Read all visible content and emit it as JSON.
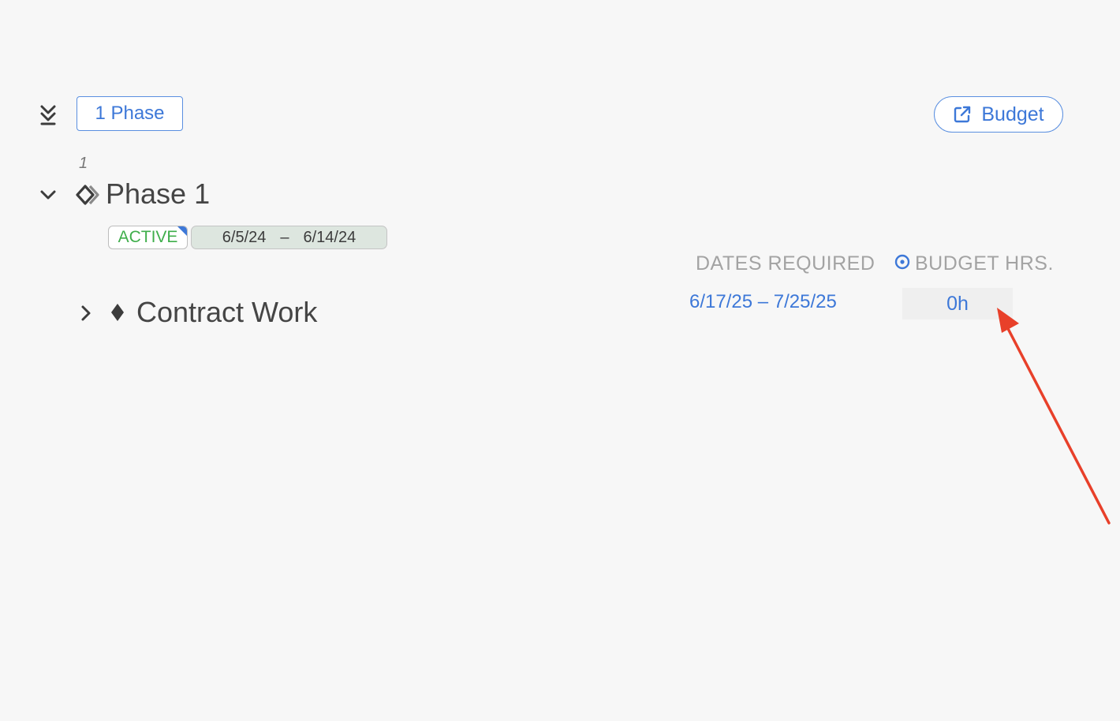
{
  "toolbar": {
    "phase_count_label": "1 Phase",
    "budget_label": "Budget"
  },
  "phase": {
    "number": "1",
    "title": "Phase 1",
    "status": "ACTIVE",
    "start_date": "6/5/24",
    "date_separator": "–",
    "end_date": "6/14/24"
  },
  "columns": {
    "dates_header": "DATES REQUIRED",
    "budget_header": "BUDGET HRS."
  },
  "rows": [
    {
      "title": "Contract Work",
      "dates": "6/17/25 – 7/25/25",
      "budget_hours": "0h"
    }
  ],
  "colors": {
    "accent": "#3d78d8",
    "status_active": "#3fae4b",
    "annotation": "#e8402a"
  },
  "icons": {
    "collapse_all": "double-chevron-down-icon",
    "budget": "external-link-icon",
    "phase": "phase-diamond-icon",
    "row": "diamond-icon",
    "budget_header": "target-icon"
  }
}
